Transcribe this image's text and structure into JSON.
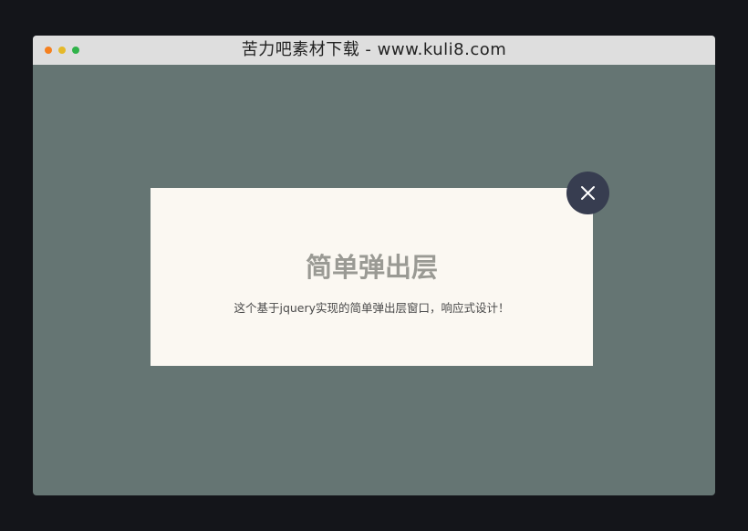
{
  "window": {
    "title": "苦力吧素材下载 - www.kuli8.com",
    "traffic_lights": {
      "close_color": "#f5801f",
      "minimize_color": "#e5b92a",
      "maximize_color": "#30b34a"
    },
    "background_color": "#657573"
  },
  "modal": {
    "title": "简单弹出层",
    "description": "这个基于jquery实现的简单弹出层窗口，响应式设计！",
    "close_icon": "close-icon",
    "close_button_color": "#373d50"
  }
}
